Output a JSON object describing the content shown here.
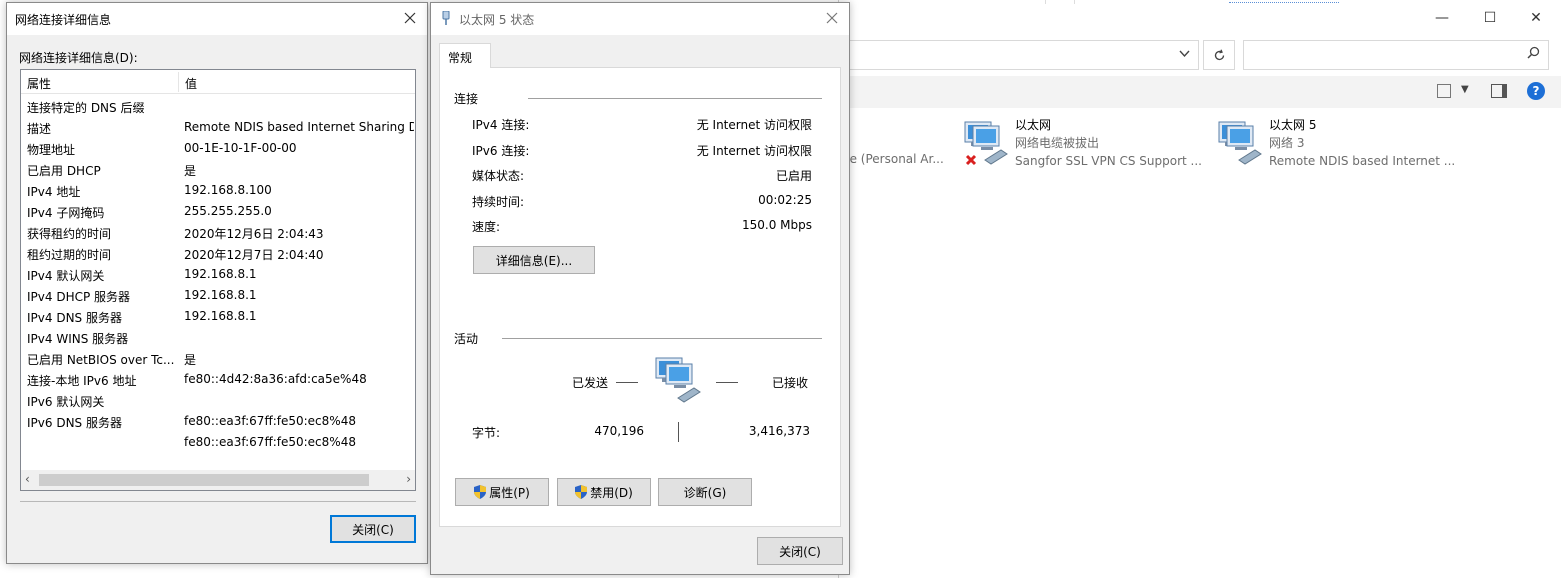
{
  "explorer": {
    "window_controls": {
      "minimize": "—",
      "maximize": "☐",
      "close": "✕"
    },
    "search_placeholder": "",
    "partial_item_text": "ce (Personal Ar...",
    "items": [
      {
        "name": "以太网",
        "status": "网络电缆被拔出",
        "adapter": "Sangfor SSL VPN CS Support ...",
        "disconnected": true
      },
      {
        "name": "以太网 5",
        "status": "网络 3",
        "adapter": "Remote NDIS based Internet ...",
        "disconnected": false
      }
    ]
  },
  "details_dialog": {
    "title": "网络连接详细信息",
    "caption": "网络连接详细信息(D):",
    "columns": {
      "property": "属性",
      "value": "值"
    },
    "rows": [
      {
        "k": "连接特定的 DNS 后缀",
        "v": ""
      },
      {
        "k": "描述",
        "v": "Remote NDIS based Internet Sharing D"
      },
      {
        "k": "物理地址",
        "v": "00-1E-10-1F-00-00"
      },
      {
        "k": "已启用 DHCP",
        "v": "是"
      },
      {
        "k": "IPv4 地址",
        "v": "192.168.8.100"
      },
      {
        "k": "IPv4 子网掩码",
        "v": "255.255.255.0"
      },
      {
        "k": "获得租约的时间",
        "v": "2020年12月6日 2:04:43"
      },
      {
        "k": "租约过期的时间",
        "v": "2020年12月7日 2:04:40"
      },
      {
        "k": "IPv4 默认网关",
        "v": "192.168.8.1"
      },
      {
        "k": "IPv4 DHCP 服务器",
        "v": "192.168.8.1"
      },
      {
        "k": "IPv4 DNS 服务器",
        "v": "192.168.8.1"
      },
      {
        "k": "IPv4 WINS 服务器",
        "v": ""
      },
      {
        "k": "已启用 NetBIOS over Tc...",
        "v": "是"
      },
      {
        "k": "连接-本地 IPv6 地址",
        "v": "fe80::4d42:8a36:afd:ca5e%48"
      },
      {
        "k": "IPv6 默认网关",
        "v": ""
      },
      {
        "k": "IPv6 DNS 服务器",
        "v": "fe80::ea3f:67ff:fe50:ec8%48"
      },
      {
        "k": "",
        "v": "fe80::ea3f:67ff:fe50:ec8%48"
      }
    ],
    "close_button": "关闭(C)"
  },
  "status_dialog": {
    "title": "以太网 5 状态",
    "tab": "常规",
    "connection_group": "连接",
    "connection": [
      {
        "k": "IPv4 连接:",
        "v": "无 Internet 访问权限"
      },
      {
        "k": "IPv6 连接:",
        "v": "无 Internet 访问权限"
      },
      {
        "k": "媒体状态:",
        "v": "已启用"
      },
      {
        "k": "持续时间:",
        "v": "00:02:25"
      },
      {
        "k": "速度:",
        "v": "150.0 Mbps"
      }
    ],
    "details_button": "详细信息(E)...",
    "activity_group": "活动",
    "sent_label": "已发送",
    "received_label": "已接收",
    "bytes_label": "字节:",
    "bytes_sent": "470,196",
    "bytes_received": "3,416,373",
    "properties_button": "属性(P)",
    "disable_button": "禁用(D)",
    "diagnose_button": "诊断(G)",
    "close_button": "关闭(C)"
  }
}
